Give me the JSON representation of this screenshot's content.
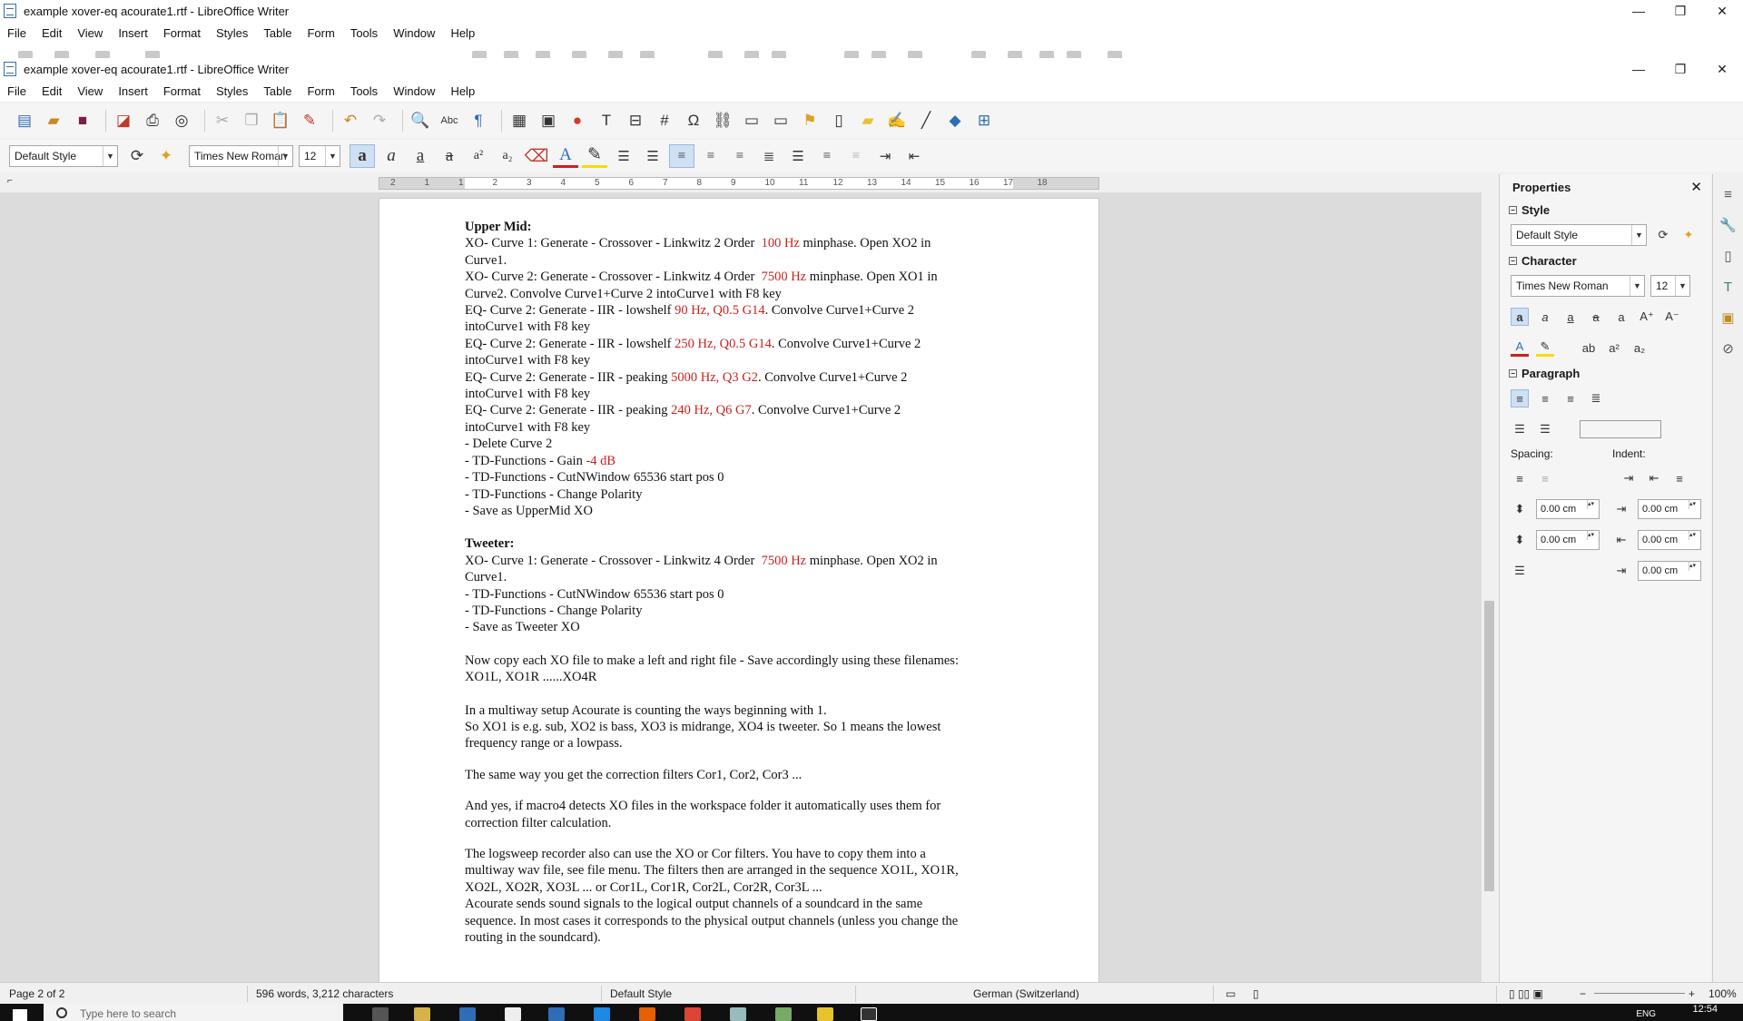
{
  "outer_window": {
    "title": "example xover-eq acourate1.rtf - LibreOffice Writer",
    "menu": [
      "File",
      "Edit",
      "View",
      "Insert",
      "Format",
      "Styles",
      "Table",
      "Form",
      "Tools",
      "Window",
      "Help"
    ]
  },
  "window": {
    "title": "example xover-eq acourate1.rtf - LibreOffice Writer",
    "menu": [
      "File",
      "Edit",
      "View",
      "Insert",
      "Format",
      "Styles",
      "Table",
      "Form",
      "Tools",
      "Window",
      "Help"
    ]
  },
  "toolbar": {
    "paragraph_style": "Default Style",
    "font_name": "Times New Roman",
    "font_size": "12",
    "bold_icon": "a",
    "italic_icon": "a",
    "underline_icon": "a",
    "strike_icon": "a",
    "special_char": "Ω"
  },
  "ruler": {
    "numbers": [
      "2",
      "1",
      "1",
      "2",
      "3",
      "4",
      "5",
      "6",
      "7",
      "8",
      "9",
      "10",
      "11",
      "12",
      "13",
      "14",
      "15",
      "16",
      "17",
      "18"
    ]
  },
  "document": {
    "upper_mid": {
      "heading": "Upper Mid:",
      "l1a": "XO- Curve 1: Generate - Crossover - Linkwitz 2 Order  ",
      "l1r": "100 Hz",
      "l1b": " minphase. Open XO2 in",
      "l2": "Curve1.",
      "l3a": "XO- Curve 2: Generate - Crossover - Linkwitz 4 Order  ",
      "l3r": "7500 Hz",
      "l3b": " minphase. Open XO1 in",
      "l4": "Curve2. Convolve Curve1+Curve 2 intoCurve1 with F8 key",
      "l5a": "EQ- Curve 2: Generate - IIR - lowshelf ",
      "l5r": "90 Hz, Q0.5 G14",
      "l5b": ". Convolve Curve1+Curve 2",
      "l6": "intoCurve1 with F8 key",
      "l7a": "EQ- Curve 2: Generate - IIR - lowshelf ",
      "l7r": "250 Hz, Q0.5 G14",
      "l7b": ". Convolve Curve1+Curve 2",
      "l8": "intoCurve1 with F8 key",
      "l9a": "EQ- Curve 2: Generate - IIR - peaking ",
      "l9r": "5000 Hz, Q3 G2",
      "l9b": ". Convolve Curve1+Curve 2",
      "l10": "intoCurve1 with F8 key",
      "l11a": "EQ- Curve 2: Generate - IIR - peaking ",
      "l11r": "240 Hz, Q6 G7",
      "l11b": ". Convolve Curve1+Curve 2",
      "l12": "intoCurve1 with F8 key",
      "l13": "- Delete Curve 2",
      "l14a": "- TD-Functions - Gain ",
      "l14r": "-4 dB",
      "l15": "- TD-Functions - CutNWindow 65536 start pos 0",
      "l16": "- TD-Functions - Change Polarity",
      "l17": "- Save as UpperMid XO"
    },
    "tweeter": {
      "heading": "Tweeter:",
      "l1a": "XO- Curve 1: Generate - Crossover - Linkwitz 4 Order  ",
      "l1r": "7500 Hz",
      "l1b": " minphase. Open XO2 in",
      "l2": "Curve1.",
      "l3": "- TD-Functions - CutNWindow 65536 start pos 0",
      "l4": "- TD-Functions - Change Polarity",
      "l5": "- Save as Tweeter XO"
    },
    "copy_p1": "Now copy each XO file to make a left and right file - Save accordingly using these filenames:",
    "copy_p2": "XO1L, XO1R ......XO4R",
    "multi_p1": "In a multiway setup Acourate is counting the ways beginning with 1.",
    "multi_p2": "So XO1 is e.g. sub, XO2 is bass, XO3 is midrange, XO4 is tweeter. So 1 means the lowest",
    "multi_p3": "frequency range or a lowpass.",
    "same_p1": "The same way you get the correction filters Cor1, Cor2, Cor3 ...",
    "macro_p1": "And yes, if macro4 detects XO files in the workspace folder it automatically uses them for",
    "macro_p2": "correction filter calculation.",
    "log_p1": "The logsweep recorder also can use the XO or Cor filters. You have to copy them into a",
    "log_p2": "multiway wav file, see file menu. The filters then are arranged in the sequence XO1L, XO1R,",
    "log_p3": "XO2L, XO2R, XO3L ... or Cor1L, Cor1R, Cor2L, Cor2R, Cor3L ...",
    "log_p4": "Acourate sends sound signals to the logical output channels of a soundcard in the same",
    "log_p5": "sequence. In most cases it corresponds to the physical output channels (unless you change the",
    "log_p6": "routing in the soundcard)."
  },
  "sidebar": {
    "title": "Properties",
    "style_section": "Style",
    "style_value": "Default Style",
    "character_section": "Character",
    "font_name": "Times New Roman",
    "font_size": "12",
    "paragraph_section": "Paragraph",
    "spacing_label": "Spacing:",
    "indent_label": "Indent:",
    "spacing_above": "0.00 cm",
    "spacing_below": "0.00 cm",
    "indent_before": "0.00 cm",
    "indent_after": "0.00 cm",
    "indent_first": "0.00 cm"
  },
  "status": {
    "page": "Page 2 of 2",
    "counts": "596 words, 3,212 characters",
    "style": "Default Style",
    "language": "German (Switzerland)",
    "zoom": "100%"
  },
  "taskbar": {
    "search_placeholder": "Type here to search",
    "language": "ENG",
    "time": "12:54"
  }
}
